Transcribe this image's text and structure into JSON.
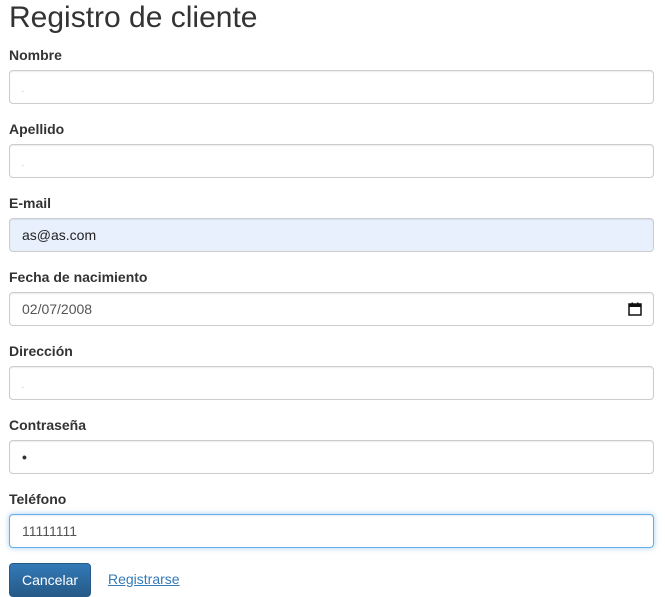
{
  "form": {
    "title": "Registro de cliente",
    "fields": {
      "nombre": {
        "label": "Nombre",
        "value": "."
      },
      "apellido": {
        "label": "Apellido",
        "value": "."
      },
      "email": {
        "label": "E-mail",
        "value": "as@as.com"
      },
      "fecha": {
        "label": "Fecha de nacimiento",
        "value": "02/07/2008"
      },
      "direccion": {
        "label": "Dirección",
        "value": "."
      },
      "contrasena": {
        "label": "Contraseña",
        "value": "•"
      },
      "telefono": {
        "label": "Teléfono",
        "value": "11111111"
      }
    },
    "actions": {
      "cancel_label": "Cancelar",
      "register_label": "Registrarse"
    }
  },
  "colors": {
    "primary": "#337ab7",
    "autofill_bg": "#e8f0fe",
    "focus_border": "#66afe9",
    "text": "#333333"
  },
  "icons": {
    "date_picker": "calendar-icon"
  }
}
